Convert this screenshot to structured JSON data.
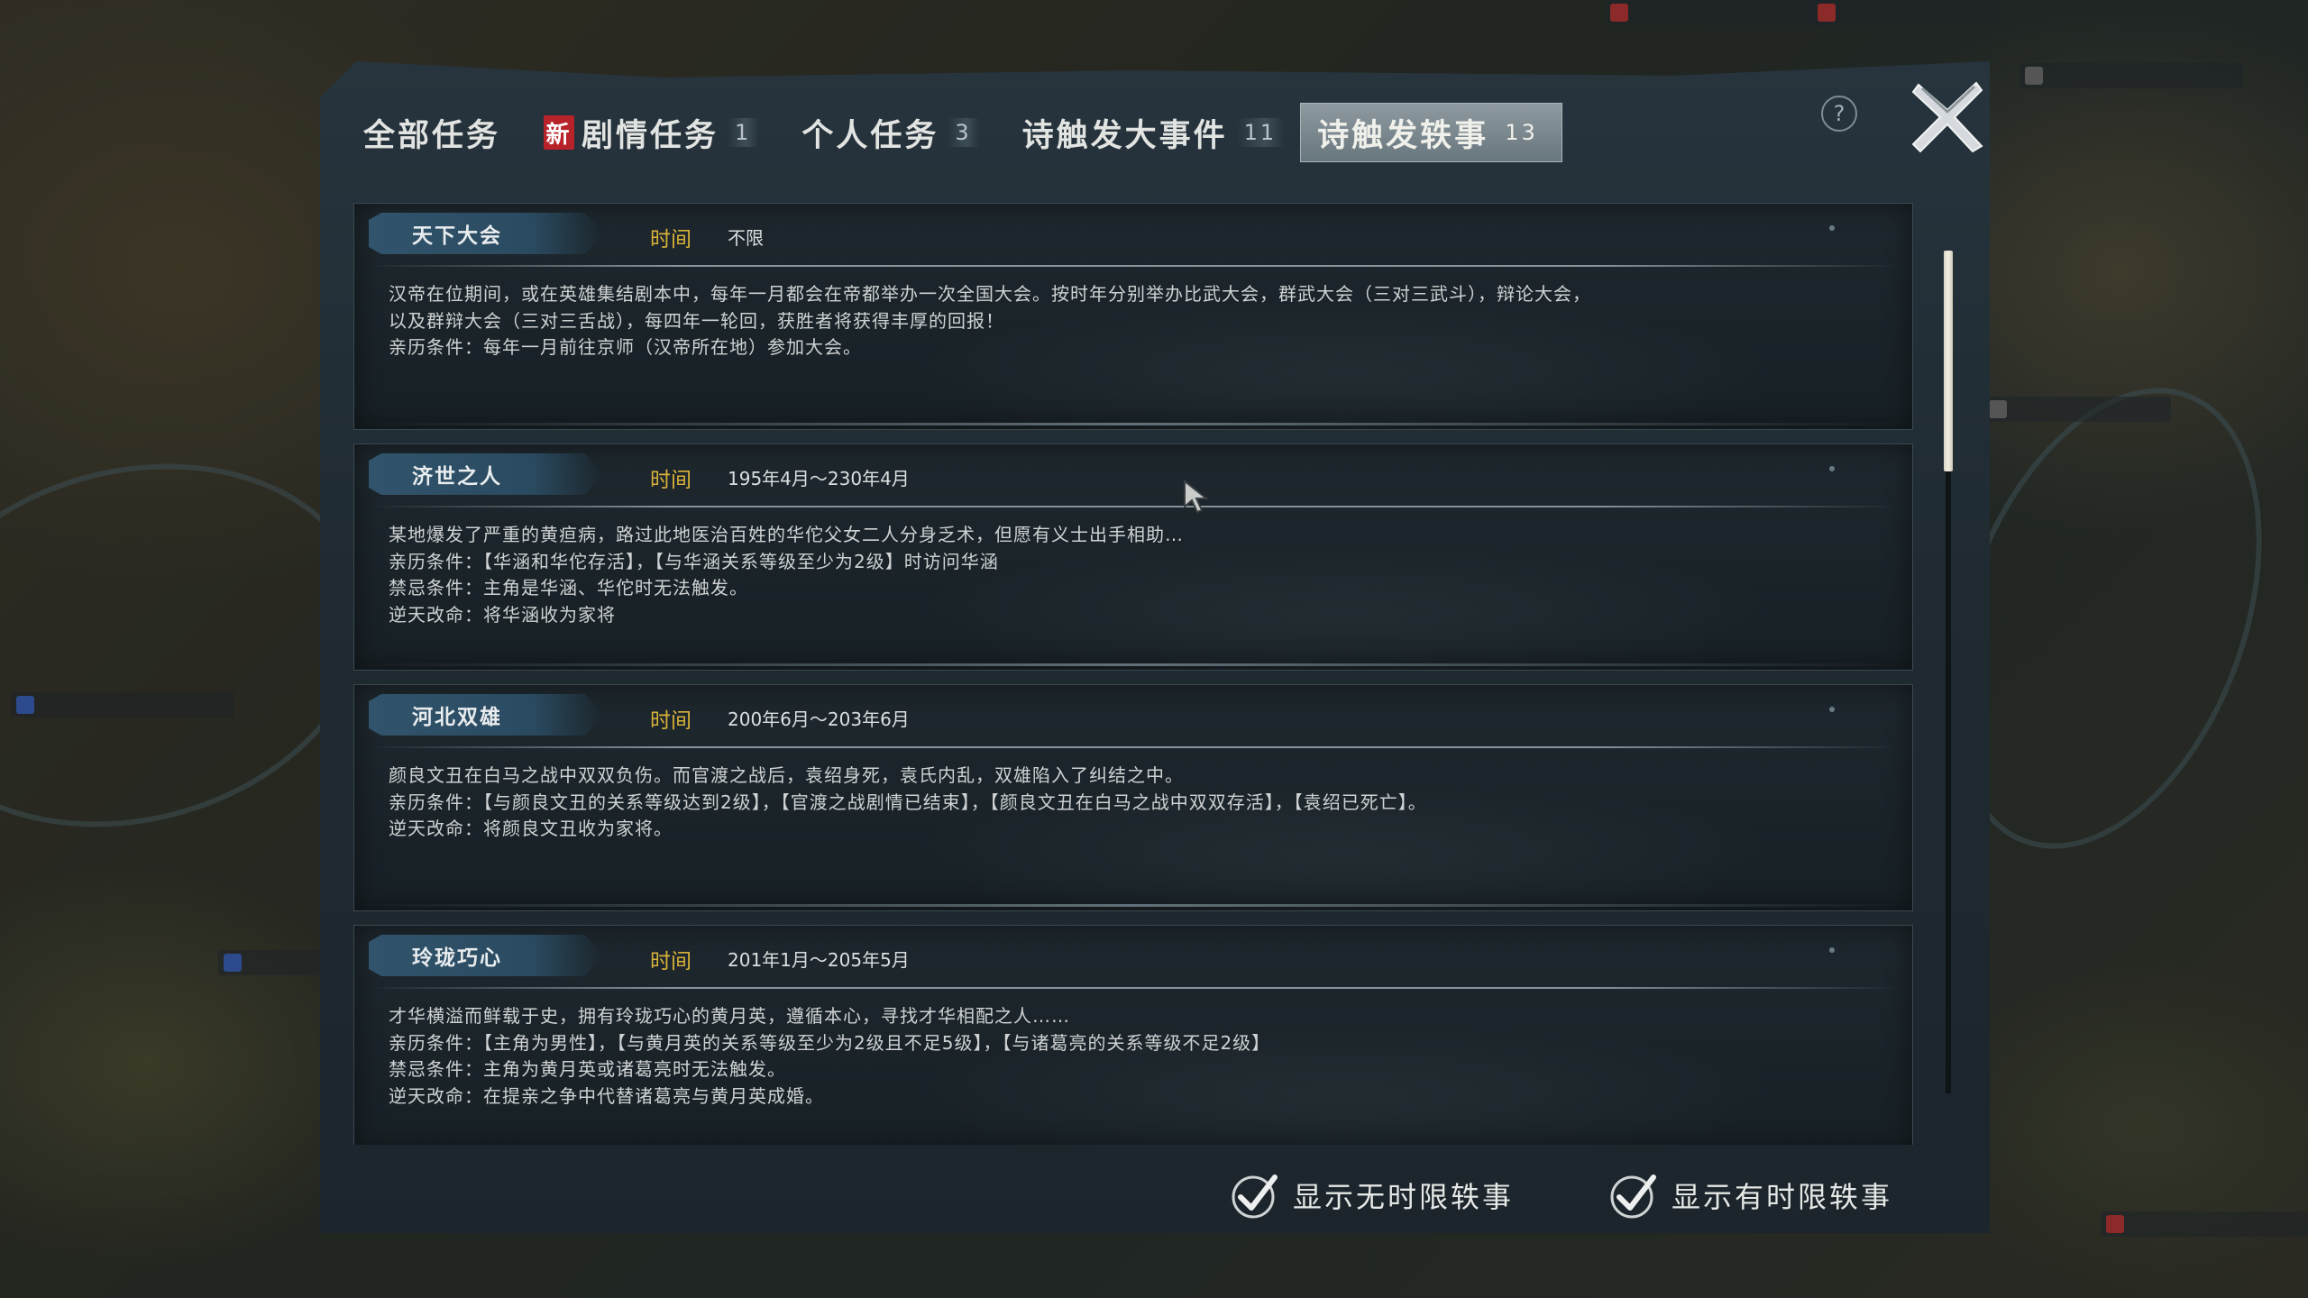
{
  "tabs": [
    {
      "label": "全部任务",
      "count": "",
      "new_badge": ""
    },
    {
      "label": "剧情任务",
      "count": "1",
      "new_badge": "新"
    },
    {
      "label": "个人任务",
      "count": "3",
      "new_badge": ""
    },
    {
      "label": "诗触发大事件",
      "count": "11",
      "new_badge": ""
    },
    {
      "label": "诗触发轶事",
      "count": "13",
      "new_badge": ""
    }
  ],
  "active_tab_index": 4,
  "help_label": "?",
  "events": [
    {
      "title": "天下大会",
      "time_label": "时间",
      "time_value": "不限",
      "lines": [
        "汉帝在位期间，或在英雄集结剧本中，每年一月都会在帝都举办一次全国大会。按时年分别举办比武大会，群武大会（三对三武斗），辩论大会，",
        "以及群辩大会（三对三舌战），每四年一轮回，获胜者将获得丰厚的回报！",
        "亲历条件：每年一月前往京师（汉帝所在地）参加大会。"
      ]
    },
    {
      "title": "济世之人",
      "time_label": "时间",
      "time_value": "195年4月～230年4月",
      "lines": [
        "某地爆发了严重的黄疸病，路过此地医治百姓的华佗父女二人分身乏术，但愿有义士出手相助…",
        "亲历条件：【华涵和华佗存活】，【与华涵关系等级至少为2级】时访问华涵",
        "禁忌条件：主角是华涵、华佗时无法触发。",
        "逆天改命：将华涵收为家将"
      ]
    },
    {
      "title": "河北双雄",
      "time_label": "时间",
      "time_value": "200年6月～203年6月",
      "lines": [
        "颜良文丑在白马之战中双双负伤。而官渡之战后，袁绍身死，袁氏内乱，双雄陷入了纠结之中。",
        "亲历条件：【与颜良文丑的关系等级达到2级】，【官渡之战剧情已结束】，【颜良文丑在白马之战中双双存活】，【袁绍已死亡】。",
        "逆天改命：将颜良文丑收为家将。"
      ]
    },
    {
      "title": "玲珑巧心",
      "time_label": "时间",
      "time_value": "201年1月～205年5月",
      "lines": [
        "才华横溢而鲜载于史，拥有玲珑巧心的黄月英，遵循本心，寻找才华相配之人……",
        "亲历条件：【主角为男性】，【与黄月英的关系等级至少为2级且不足5级】，【与诸葛亮的关系等级不足2级】",
        "禁忌条件：主角为黄月英或诸葛亮时无法触发。",
        "逆天改命：在提亲之争中代替诸葛亮与黄月英成婚。"
      ]
    }
  ],
  "footer": {
    "show_untimed": "显示无时限轶事",
    "show_timed": "显示有时限轶事"
  },
  "colors": {
    "time_label": "#d9b23a",
    "new_badge": "#b8232a",
    "ribbon": "#31546c"
  }
}
